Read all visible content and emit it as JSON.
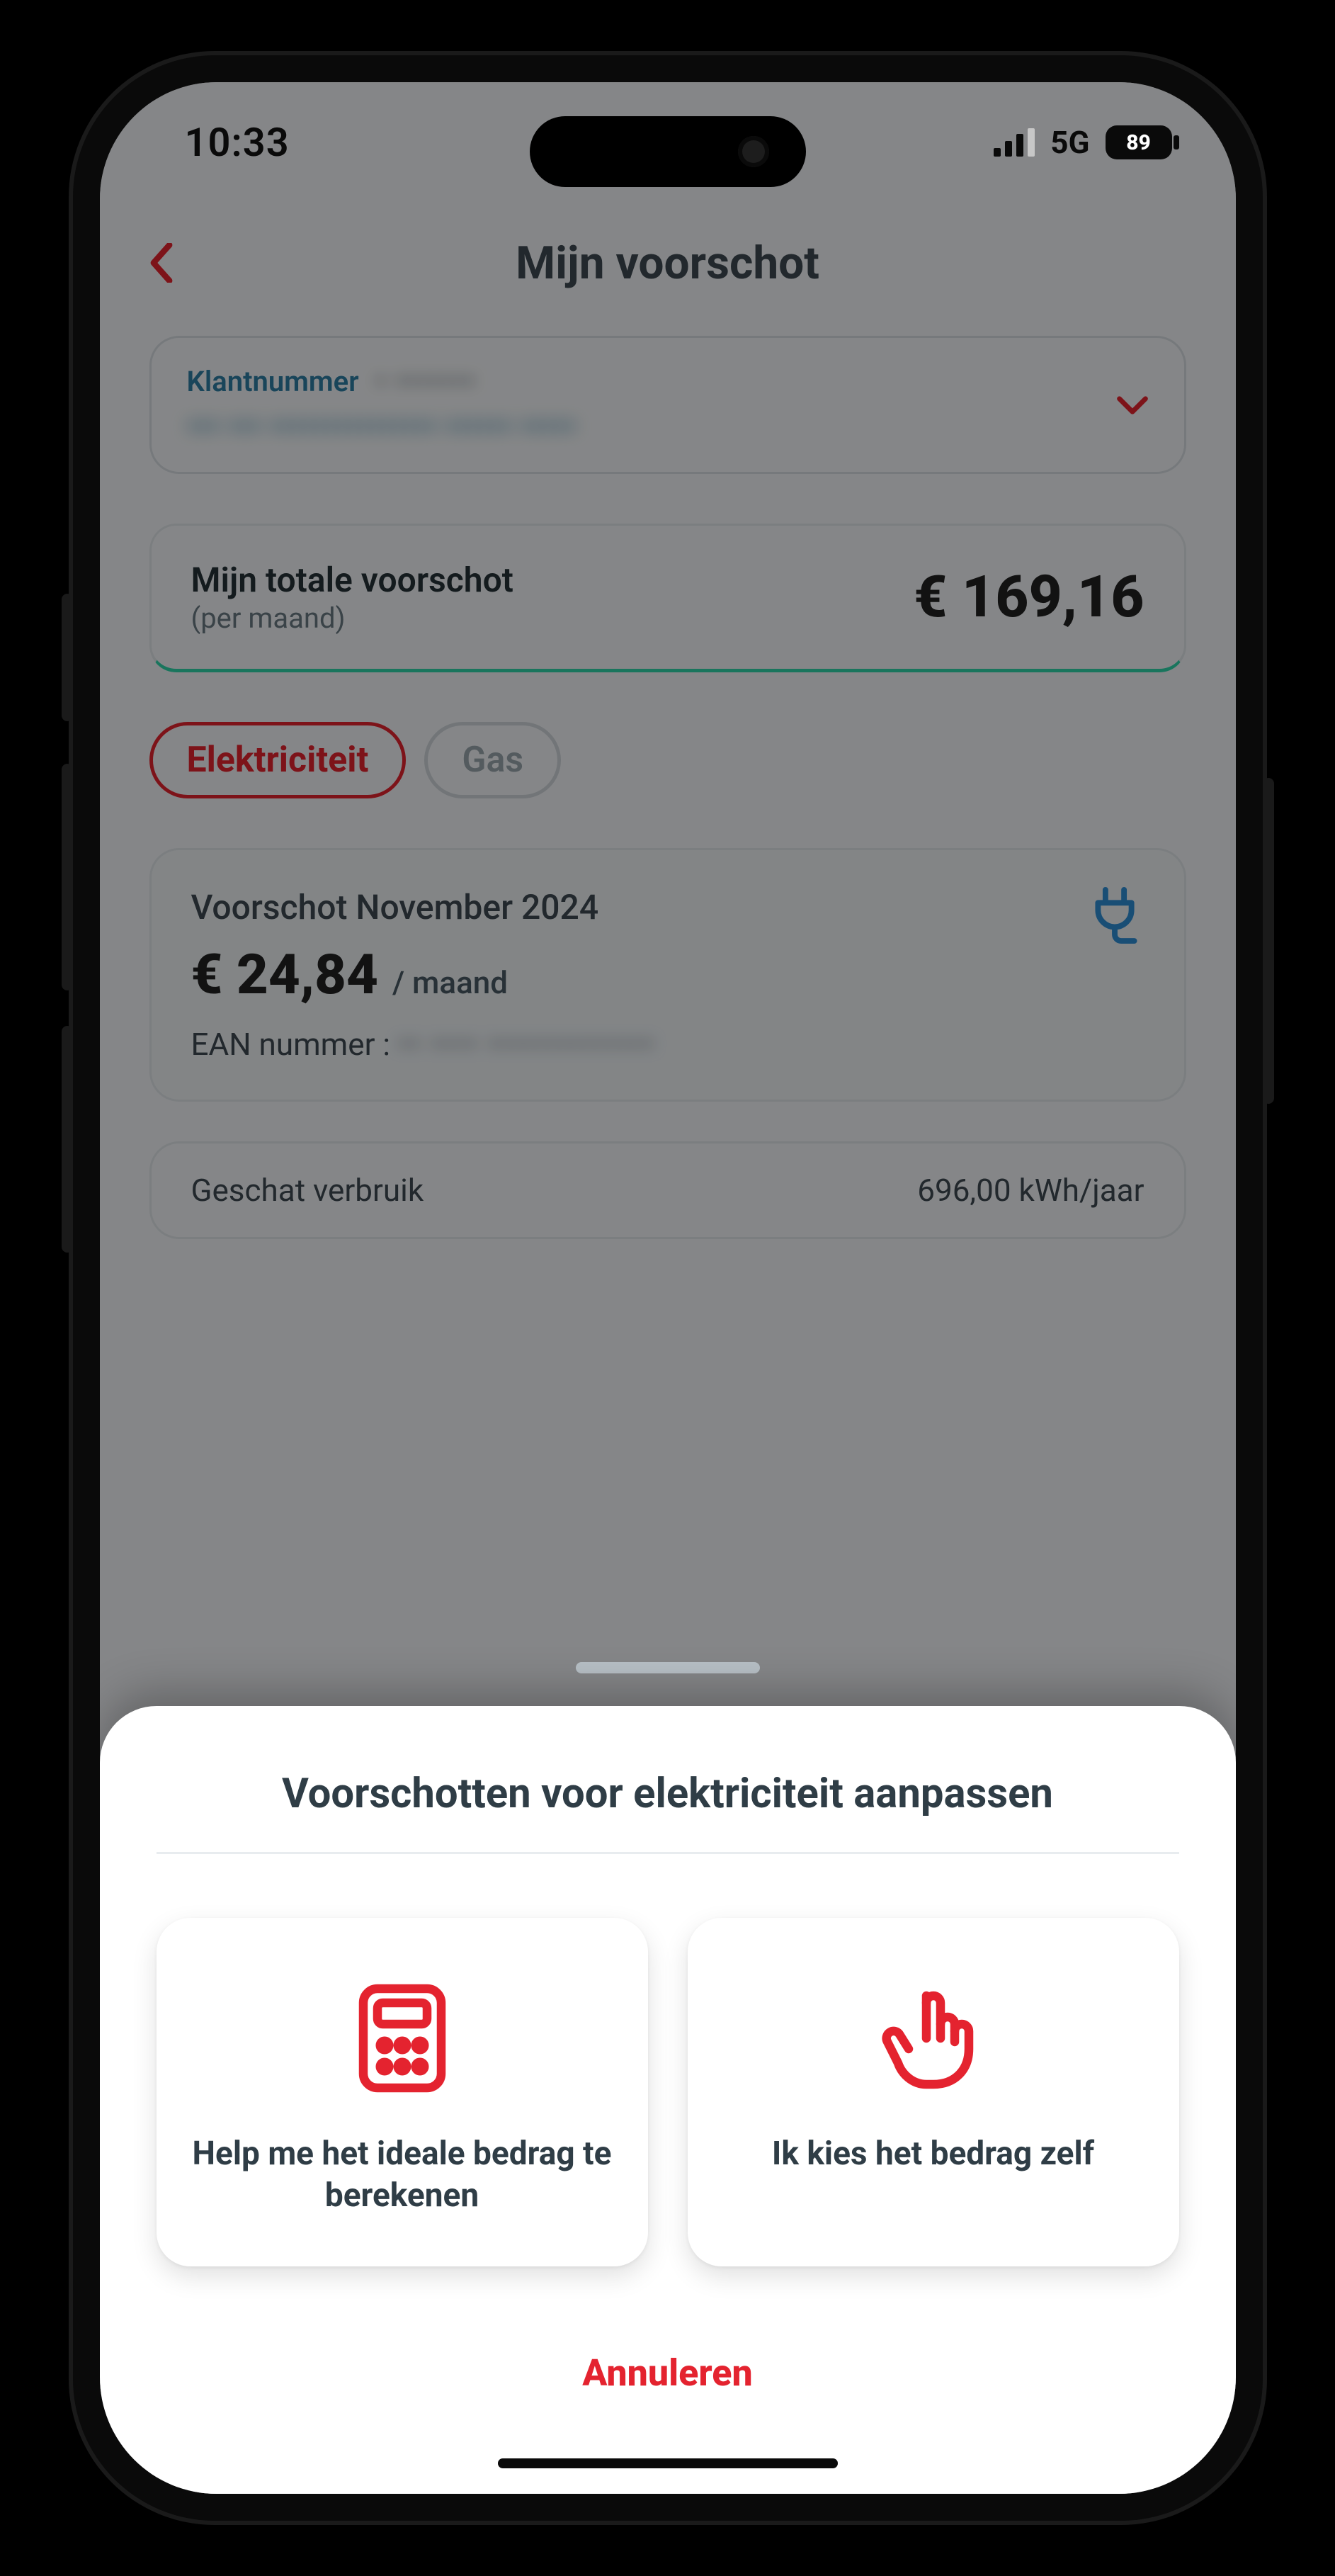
{
  "status": {
    "time": "10:33",
    "network": "5G",
    "battery": "89"
  },
  "nav": {
    "title": "Mijn voorschot"
  },
  "account": {
    "label": "Klantnummer",
    "number_masked": "• •••••••",
    "address_masked": "••• ••• ••••••••••••••• •••••• •••••"
  },
  "total": {
    "label": "Mijn totale voorschot",
    "sub": "(per maand)",
    "amount": "€ 169,16"
  },
  "tabs": {
    "elec": "Elektriciteit",
    "gas": "Gas"
  },
  "elec": {
    "title": "Voorschot November 2024",
    "amount": "€ 24,84",
    "per": "/ maand",
    "ean_label": "EAN nummer :",
    "ean_masked": "•• •••• ••••••••••••••"
  },
  "estimate": {
    "label": "Geschat verbruik",
    "value": "696,00 kWh/jaar"
  },
  "sheet": {
    "title": "Voorschotten voor elektriciteit aanpassen",
    "opt1": "Help me het ideale bedrag te berekenen",
    "opt2": "Ik kies het bedrag zelf",
    "cancel": "Annuleren"
  }
}
